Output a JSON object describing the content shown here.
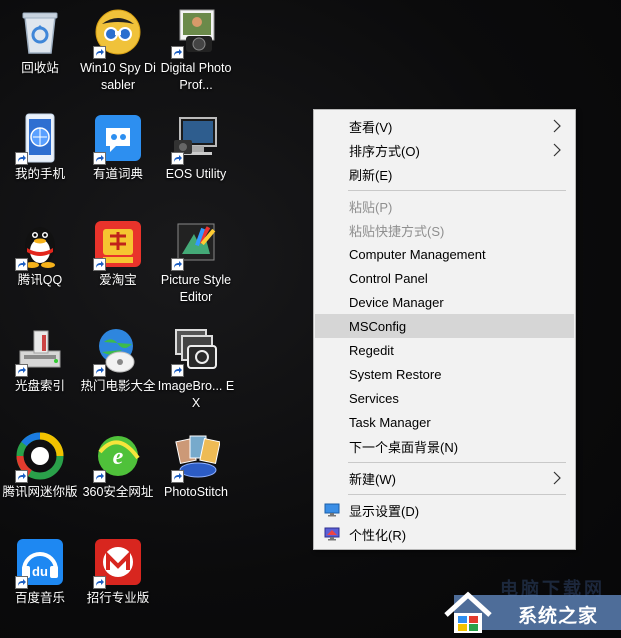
{
  "desktop_icons": [
    {
      "label": "回收站",
      "icon": "recycle-bin-icon"
    },
    {
      "label": "Win10 Spy Disabler",
      "icon": "spy-binoculars-icon"
    },
    {
      "label": "Digital Photo Prof...",
      "icon": "camera-photo-icon"
    },
    {
      "label": "我的手机",
      "icon": "phone-icon"
    },
    {
      "label": "有道词典",
      "icon": "youdao-dict-icon"
    },
    {
      "label": "EOS Utility",
      "icon": "computer-camera-icon"
    },
    {
      "label": "腾讯QQ",
      "icon": "qq-penguin-icon"
    },
    {
      "label": "爱淘宝",
      "icon": "taobao-icon"
    },
    {
      "label": "Picture Style Editor",
      "icon": "picture-style-icon"
    },
    {
      "label": "光盘索引",
      "icon": "disc-index-icon"
    },
    {
      "label": "热门电影大全",
      "icon": "movie-globe-icon"
    },
    {
      "label": "ImageBro... EX",
      "icon": "imagebrowser-icon"
    },
    {
      "label": "腾讯网迷你版",
      "icon": "tencent-mini-icon"
    },
    {
      "label": "360安全网址",
      "icon": "360-browser-icon"
    },
    {
      "label": "PhotoStitch",
      "icon": "photostitch-icon"
    },
    {
      "label": "百度音乐",
      "icon": "baidu-music-icon"
    },
    {
      "label": "招行专业版",
      "icon": "cmb-bank-icon"
    }
  ],
  "context_menu": {
    "items": [
      {
        "label": "查看(V)",
        "submenu": true
      },
      {
        "label": "排序方式(O)",
        "submenu": true
      },
      {
        "label": "刷新(E)"
      },
      {
        "label": "粘贴(P)",
        "disabled": true
      },
      {
        "label": "粘贴快捷方式(S)",
        "disabled": true
      },
      {
        "label": "Computer Management"
      },
      {
        "label": "Control Panel"
      },
      {
        "label": "Device Manager"
      },
      {
        "label": "MSConfig",
        "highlighted": true
      },
      {
        "label": "Regedit"
      },
      {
        "label": "System Restore"
      },
      {
        "label": "Services"
      },
      {
        "label": "Task Manager"
      },
      {
        "label": "下一个桌面背景(N)"
      },
      {
        "label": "新建(W)",
        "submenu": true
      },
      {
        "label": "显示设置(D)",
        "icon": "display-settings-icon"
      },
      {
        "label": "个性化(R)",
        "icon": "personalize-icon"
      }
    ]
  },
  "watermark": {
    "text": "系统之家",
    "faint_text": "电脑下载网"
  },
  "colors": {
    "menu_bg": "#f2f2f2",
    "menu_highlight": "#d6d6d6",
    "menu_disabled_text": "#8f8f8f"
  }
}
